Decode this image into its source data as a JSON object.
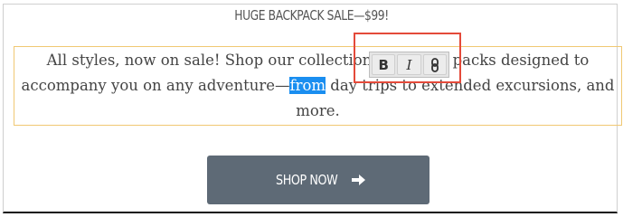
{
  "headline": {
    "text": "HUGE BACKPACK SALE—$99!"
  },
  "body": {
    "before": "All styles, now on sale! Shop our collection of quality packs designed to accompany you on any adventure—",
    "selected": "from",
    "after": " day trips to extended excursions, and more."
  },
  "toolbar": {
    "bold_label": "B",
    "italic_label": "I",
    "link_icon": "link-icon"
  },
  "cta": {
    "label": "SHOP NOW",
    "icon": "arrow-right-icon"
  },
  "colors": {
    "selection": "#1a8ef0",
    "highlight": "#e44a3a",
    "button": "#5e6a76",
    "block_border": "#f0c873"
  }
}
